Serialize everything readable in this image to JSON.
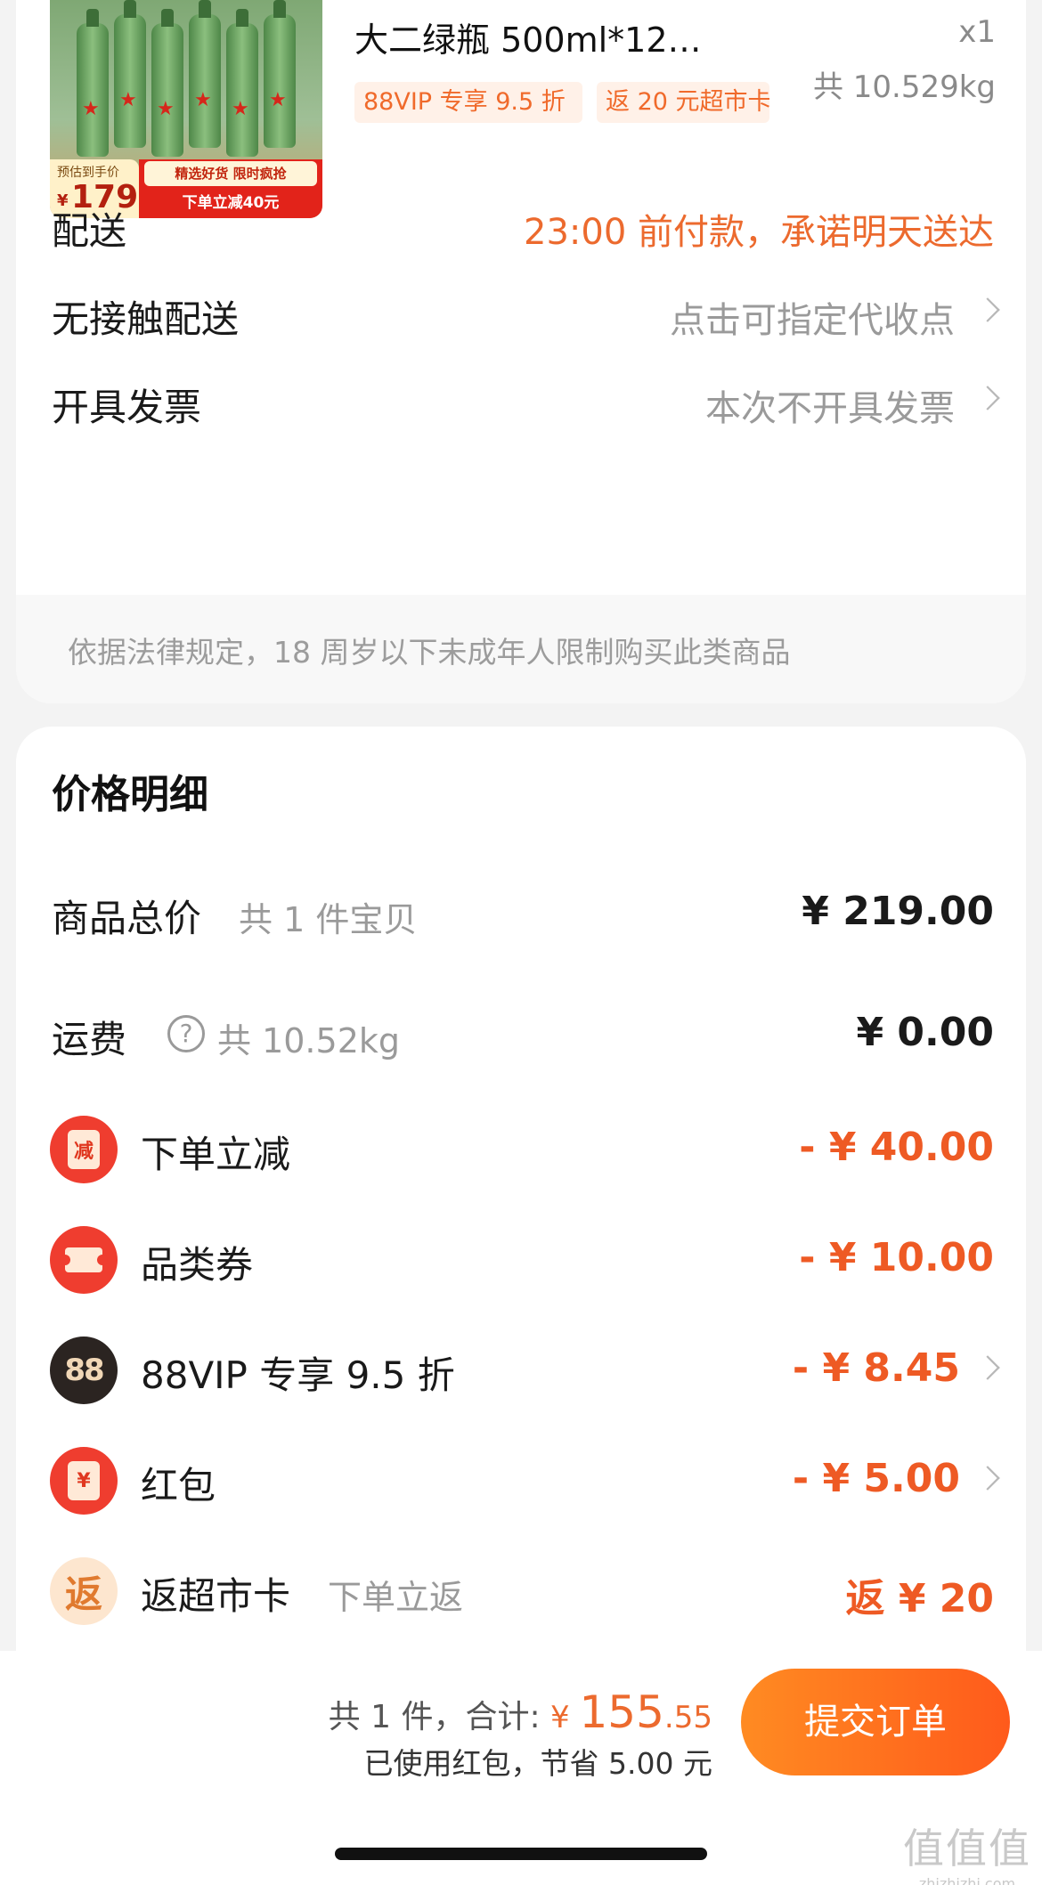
{
  "product": {
    "title": "大二绿瓶 500ml*12…",
    "qty": "x1",
    "weight": "共 10.529kg",
    "tag_vip": "88VIP 专享 9.5 折",
    "tag_return": "返 20 元超市卡",
    "thumb": {
      "est_label": "预估到手价",
      "yen": "¥",
      "price": "179",
      "tags": "精选好货 限时疯抢",
      "cut": "下单立减40元"
    }
  },
  "rows": {
    "delivery": {
      "label": "配送",
      "value": "23:00 前付款，承诺明天送达"
    },
    "contactless": {
      "label": "无接触配送",
      "value": "点击可指定代收点"
    },
    "invoice": {
      "label": "开具发票",
      "value": "本次不开具发票"
    }
  },
  "notice": "依据法律规定，18 周岁以下未成年人限制购买此类商品",
  "price_detail": {
    "title": "价格明细",
    "items": [
      {
        "label": "商品总价",
        "sub": "共 1 件宝贝",
        "value": "¥ 219.00"
      },
      {
        "label": "运费",
        "sub": "共 10.52kg",
        "value": "¥ 0.00"
      },
      {
        "label": "下单立减",
        "icon_text": "减",
        "value": "- ¥ 40.00"
      },
      {
        "label": "品类券",
        "value": "- ¥ 10.00"
      },
      {
        "label": "88VIP 专享 9.5 折",
        "icon_text": "88",
        "value": "- ¥ 8.45"
      },
      {
        "label": "红包",
        "icon_text": "¥",
        "value": "- ¥ 5.00"
      },
      {
        "label": "返超市卡",
        "sub": "下单立返",
        "icon_text": "返",
        "value": "返 ¥ 20"
      }
    ]
  },
  "footer": {
    "count_total_label": "共 1 件，合计: ",
    "yen": "¥ ",
    "total_int": "155",
    "total_dec": ".55",
    "saved": "已使用红包，节省 5.00 元",
    "submit": "提交订单"
  },
  "watermark": {
    "big": "值值值",
    "small": "zhizhizhi.com"
  },
  "colors": {
    "accent_orange": "#ec6a2e",
    "discount_red": "#ee5a24",
    "button_start": "#ff8b22",
    "button_end": "#ff5a1b"
  },
  "icons": [
    "reduce-icon",
    "coupon-icon",
    "vip88-icon",
    "red-packet-icon",
    "return-card-icon",
    "help-icon",
    "chevron-right-icon"
  ]
}
